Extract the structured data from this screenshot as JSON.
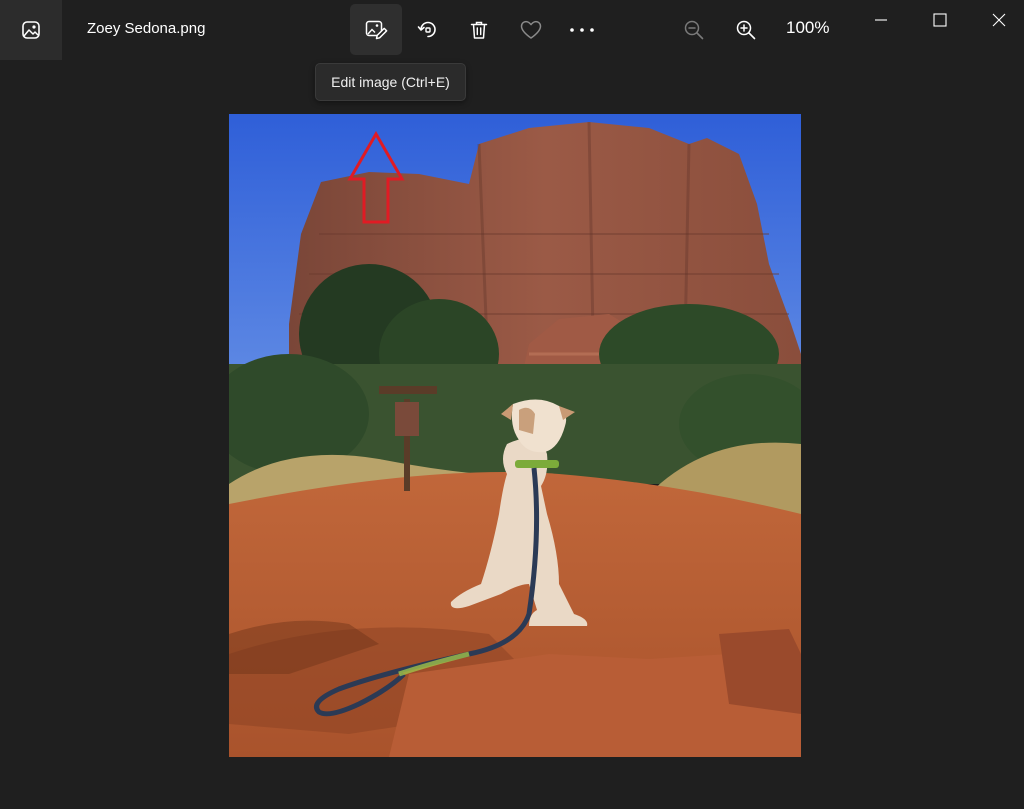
{
  "window": {
    "file_name": "Zoey Sedona.png",
    "zoom_level": "100%"
  },
  "toolbar": {
    "buttons": [
      {
        "name": "edit-image",
        "icon": "edit-image-icon",
        "active": true
      },
      {
        "name": "rotate",
        "icon": "rotate-icon"
      },
      {
        "name": "delete",
        "icon": "trash-icon"
      },
      {
        "name": "favorite",
        "icon": "heart-icon"
      },
      {
        "name": "more",
        "icon": "more-icon"
      },
      {
        "name": "zoom-out",
        "icon": "zoom-out-icon"
      },
      {
        "name": "zoom-in",
        "icon": "zoom-in-icon"
      }
    ],
    "tooltip": "Edit image (Ctrl+E)"
  },
  "window_controls": [
    "minimize",
    "maximize",
    "close"
  ],
  "colors": {
    "background": "#1f1f1f",
    "app_button_bg": "#2c2c2c",
    "active_button_bg": "#2f2f2f",
    "arrow": "#e01b24"
  }
}
